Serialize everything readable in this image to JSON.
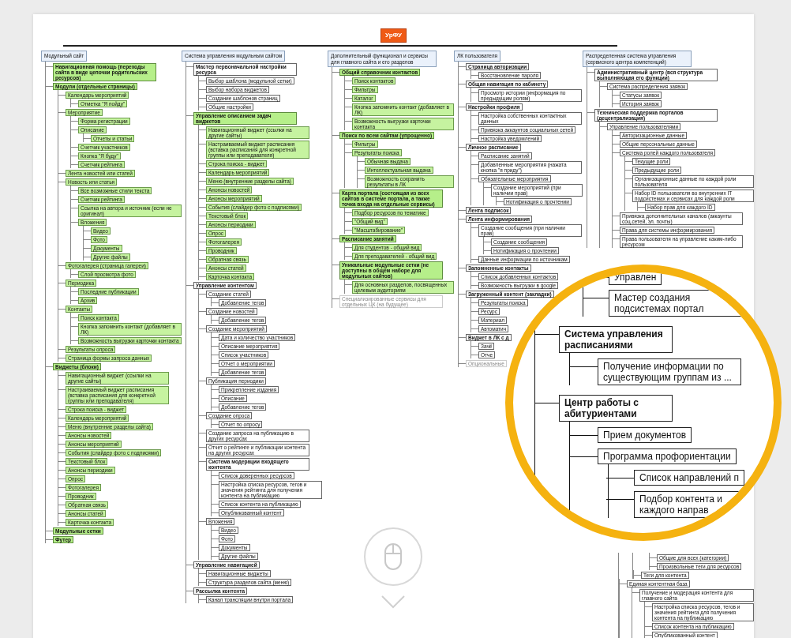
{
  "root": {
    "text": "УрФУ"
  },
  "columns": [
    {
      "title": "Модульный сайт",
      "items": [
        {
          "text": "Навигационная помощь (переходы сайта в виде цепочки родительских ресурсов)",
          "kind": "module"
        },
        {
          "text": "Модули (отдельные страницы)",
          "kind": "module",
          "children": [
            {
              "text": "Календарь мероприятий",
              "kind": "feature",
              "children": [
                {
                  "text": "Отметка \"Я пойду\"",
                  "kind": "feature"
                }
              ]
            },
            {
              "text": "Мероприятие",
              "kind": "feature",
              "children": [
                {
                  "text": "Форма регистрации",
                  "kind": "feature"
                },
                {
                  "text": "Описание",
                  "kind": "feature",
                  "children": [
                    {
                      "text": "Отчеты и статьи",
                      "kind": "feature"
                    }
                  ]
                },
                {
                  "text": "Счетчик участников",
                  "kind": "feature"
                },
                {
                  "text": "Кнопка \"Я буду\"",
                  "kind": "feature"
                },
                {
                  "text": "Счетчик рейтинга",
                  "kind": "feature"
                }
              ]
            },
            {
              "text": "Лента новостей или статей",
              "kind": "feature"
            },
            {
              "text": "Новость или статья",
              "kind": "feature",
              "children": [
                {
                  "text": "Все возможные стили текста",
                  "kind": "feature"
                },
                {
                  "text": "Счетчик рейтинга",
                  "kind": "feature"
                },
                {
                  "text": "Ссылка на автора и источник (если не оригинал)",
                  "kind": "feature"
                },
                {
                  "text": "Вложения",
                  "kind": "feature",
                  "children": [
                    {
                      "text": "Видео",
                      "kind": "feature"
                    },
                    {
                      "text": "Фото",
                      "kind": "feature"
                    },
                    {
                      "text": "Документы",
                      "kind": "feature"
                    },
                    {
                      "text": "Другие файлы",
                      "kind": "feature"
                    }
                  ]
                }
              ]
            },
            {
              "text": "Фотогалерея (страница галереи)",
              "kind": "feature",
              "children": [
                {
                  "text": "Слой просмотра фото",
                  "kind": "feature"
                }
              ]
            },
            {
              "text": "Периодика",
              "kind": "feature",
              "children": [
                {
                  "text": "Последние публикации",
                  "kind": "feature"
                },
                {
                  "text": "Архив",
                  "kind": "feature"
                }
              ]
            },
            {
              "text": "Контакты",
              "kind": "feature",
              "children": [
                {
                  "text": "Поиск контакта",
                  "kind": "feature"
                },
                {
                  "text": "Кнопка запомнить контакт (добавляет в ЛК)",
                  "kind": "feature"
                },
                {
                  "text": "Возможность выгрузки карточки контакта",
                  "kind": "feature"
                }
              ]
            },
            {
              "text": "Результаты опроса",
              "kind": "feature"
            },
            {
              "text": "Страница формы запроса данных",
              "kind": "feature"
            }
          ]
        },
        {
          "text": "Виджеты (блоки)",
          "kind": "module",
          "children": [
            {
              "text": "Навигационный виджет (ссылки на другие сайты)",
              "kind": "feature"
            },
            {
              "text": "Настраиваемый виджет расписания (вставка расписания для конкретной группы или преподавателя)",
              "kind": "feature"
            },
            {
              "text": "Строка поиска - виджет",
              "kind": "feature"
            },
            {
              "text": "Календарь мероприятий",
              "kind": "feature"
            },
            {
              "text": "Меню (внутренние разделы сайта)",
              "kind": "feature"
            },
            {
              "text": "Анонсы новостей",
              "kind": "feature"
            },
            {
              "text": "Анонсы мероприятий",
              "kind": "feature"
            },
            {
              "text": "События (слайдер фото с подписями)",
              "kind": "feature"
            },
            {
              "text": "Текстовый блок",
              "kind": "feature"
            },
            {
              "text": "Анонсы периодики",
              "kind": "feature"
            },
            {
              "text": "Опрос",
              "kind": "feature"
            },
            {
              "text": "Фотогалерея",
              "kind": "feature"
            },
            {
              "text": "Проводник",
              "kind": "feature"
            },
            {
              "text": "Обратная связь",
              "kind": "feature"
            },
            {
              "text": "Анонсы статей",
              "kind": "feature"
            },
            {
              "text": "Карточка контакта",
              "kind": "feature"
            }
          ]
        },
        {
          "text": "Модульные сетки",
          "kind": "module"
        },
        {
          "text": "Футер",
          "kind": "module"
        }
      ]
    },
    {
      "title": "Система управления модульным сайтом",
      "items": [
        {
          "text": "Мастер первоначальной настройки ресурса",
          "kind": "group",
          "children": [
            {
              "text": "Выбор шаблона (модульной сетки)",
              "kind": "item"
            },
            {
              "text": "Выбор набора виджетов",
              "kind": "item"
            },
            {
              "text": "Создание шаблонов страниц",
              "kind": "item"
            },
            {
              "text": "Общие настройки",
              "kind": "item"
            }
          ]
        },
        {
          "text": "Управление описанием задач виджетов",
          "kind": "module",
          "children": [
            {
              "text": "Навигационный виджет (ссылки на другие сайты)",
              "kind": "feature"
            },
            {
              "text": "Настраиваемый виджет расписания (вставка расписания для конкретной группы или преподавателя)",
              "kind": "feature"
            },
            {
              "text": "Строка поиска - виджет",
              "kind": "feature"
            },
            {
              "text": "Календарь мероприятий",
              "kind": "feature"
            },
            {
              "text": "Меню (внутренние разделы сайта)",
              "kind": "feature"
            },
            {
              "text": "Анонсы новостей",
              "kind": "feature"
            },
            {
              "text": "Анонсы мероприятий",
              "kind": "feature"
            },
            {
              "text": "События (слайдер фото с подписями)",
              "kind": "feature"
            },
            {
              "text": "Текстовый блок",
              "kind": "feature"
            },
            {
              "text": "Анонсы периодики",
              "kind": "feature"
            },
            {
              "text": "Опрос",
              "kind": "feature"
            },
            {
              "text": "Фотогалерея",
              "kind": "feature"
            },
            {
              "text": "Проводник",
              "kind": "feature"
            },
            {
              "text": "Обратная связь",
              "kind": "feature"
            },
            {
              "text": "Анонсы статей",
              "kind": "feature"
            },
            {
              "text": "Карточка контакта",
              "kind": "feature"
            }
          ]
        },
        {
          "text": "Управление контентом",
          "kind": "group",
          "children": [
            {
              "text": "Создание статей",
              "kind": "item",
              "children": [
                {
                  "text": "Добавление тегов",
                  "kind": "item"
                }
              ]
            },
            {
              "text": "Создание новостей",
              "kind": "item",
              "children": [
                {
                  "text": "Добавление тегов",
                  "kind": "item"
                }
              ]
            },
            {
              "text": "Создание мероприятий",
              "kind": "item",
              "children": [
                {
                  "text": "Дата и количество участников",
                  "kind": "item"
                },
                {
                  "text": "Описание мероприятия",
                  "kind": "item"
                },
                {
                  "text": "Список участников",
                  "kind": "item"
                },
                {
                  "text": "Отчет о мероприятии",
                  "kind": "item"
                },
                {
                  "text": "Добавление тегов",
                  "kind": "item"
                }
              ]
            },
            {
              "text": "Публикация периодики",
              "kind": "item",
              "children": [
                {
                  "text": "Прикрепление издания",
                  "kind": "item"
                },
                {
                  "text": "Описание",
                  "kind": "item"
                },
                {
                  "text": "Добавление тегов",
                  "kind": "item"
                }
              ]
            },
            {
              "text": "Создание опроса",
              "kind": "item",
              "children": [
                {
                  "text": "Отчет по опросу",
                  "kind": "item"
                }
              ]
            },
            {
              "text": "Создание запроса на публикацию в других ресурсах",
              "kind": "item"
            },
            {
              "text": "Отчет о рейтинге и публикации контента на других ресурсах",
              "kind": "item"
            },
            {
              "text": "Система модерации входящего контента",
              "kind": "group",
              "children": [
                {
                  "text": "Список доверенных ресурсов",
                  "kind": "item"
                },
                {
                  "text": "Настройка списка ресурсов, тегов и значения рейтинга для получения контента на публикацию",
                  "kind": "item"
                },
                {
                  "text": "Список контента на публикацию",
                  "kind": "item"
                },
                {
                  "text": "Опубликованный контент",
                  "kind": "item"
                }
              ]
            },
            {
              "text": "Вложения",
              "kind": "item",
              "children": [
                {
                  "text": "Видео",
                  "kind": "item"
                },
                {
                  "text": "Фото",
                  "kind": "item"
                },
                {
                  "text": "Документы",
                  "kind": "item"
                },
                {
                  "text": "Другие файлы",
                  "kind": "item"
                }
              ]
            }
          ]
        },
        {
          "text": "Управление навигацией",
          "kind": "group",
          "children": [
            {
              "text": "Навигационные виджеты",
              "kind": "item"
            },
            {
              "text": "Структура разделов сайта (меню)",
              "kind": "item"
            }
          ]
        },
        {
          "text": "Рассылка контента",
          "kind": "group",
          "children": [
            {
              "text": "Канал трансляции внутри портала",
              "kind": "item"
            }
          ]
        }
      ]
    },
    {
      "title": "Дополнительный функционал и сервисы для главного сайта и его разделов",
      "items": [
        {
          "text": "Общий справочник контактов",
          "kind": "module",
          "children": [
            {
              "text": "Поиск контактов",
              "kind": "feature"
            },
            {
              "text": "Фильтры",
              "kind": "feature"
            },
            {
              "text": "Каталог",
              "kind": "feature"
            },
            {
              "text": "Кнопка запомнить контакт (добавляет в ЛК)",
              "kind": "feature"
            },
            {
              "text": "Возможность выгрузки карточки контакта",
              "kind": "feature"
            }
          ]
        },
        {
          "text": "Поиск по всем сайтам (упрощенно)",
          "kind": "module",
          "children": [
            {
              "text": "Фильтры",
              "kind": "feature"
            },
            {
              "text": "Результаты поиска",
              "kind": "feature",
              "children": [
                {
                  "text": "Обычная выдача",
                  "kind": "feature"
                },
                {
                  "text": "Интеллектуальная выдача",
                  "kind": "feature"
                },
                {
                  "text": "Возможность сохранить результаты в ЛК",
                  "kind": "feature"
                }
              ]
            }
          ]
        },
        {
          "text": "Карта портала (состоящая из всех сайтов в системе портала, а также точка входа на отдельные сервисы)",
          "kind": "module",
          "children": [
            {
              "text": "Подбор ресурсов по тематике",
              "kind": "feature"
            },
            {
              "text": "\"Общий вид\"",
              "kind": "feature"
            },
            {
              "text": "\"Масштабирование\"",
              "kind": "feature"
            }
          ]
        },
        {
          "text": "Расписание занятий",
          "kind": "module",
          "children": [
            {
              "text": "Для студентов - общий вид",
              "kind": "feature"
            },
            {
              "text": "Для преподавателей - общий вид",
              "kind": "feature"
            }
          ]
        },
        {
          "text": "Уникальные модульные сетки (не доступны в общем наборе для модульных сайтов)",
          "kind": "module",
          "children": [
            {
              "text": "Для основных разделов, посвященных целевым аудиториям",
              "kind": "feature"
            }
          ]
        }
      ],
      "footnote": "Специализированные сервисы для отдельных ЦК (на будущее)"
    },
    {
      "title": "ЛК пользователя",
      "items": [
        {
          "text": "Страница авторизации",
          "kind": "group",
          "children": [
            {
              "text": "Восстановление пароля",
              "kind": "item"
            }
          ]
        },
        {
          "text": "Общая навигация по кабинету",
          "kind": "group",
          "children": [
            {
              "text": "Просмотр истории (информация по предыдущим ролям)",
              "kind": "item"
            }
          ]
        },
        {
          "text": "Настройки профиля",
          "kind": "group",
          "children": [
            {
              "text": "Настройка собственных контактных данных",
              "kind": "item"
            },
            {
              "text": "Привязка аккаунтов социальных сетей",
              "kind": "item"
            },
            {
              "text": "Настройка уведомлений",
              "kind": "item"
            }
          ]
        },
        {
          "text": "Личное расписание",
          "kind": "group",
          "children": [
            {
              "text": "Расписание занятий",
              "kind": "item"
            },
            {
              "text": "Добавленные мероприятия (нажата кнопка \"я приду\")",
              "kind": "item"
            },
            {
              "text": "Обязательные мероприятия",
              "kind": "item",
              "children": [
                {
                  "text": "Создание мероприятий (при наличии прав)",
                  "kind": "item",
                  "children": [
                    {
                      "text": "Нотификация о прочтении",
                      "kind": "item"
                    }
                  ]
                }
              ]
            }
          ]
        },
        {
          "text": "Лента подписок",
          "kind": "group"
        },
        {
          "text": "Лента информирования",
          "kind": "group",
          "children": [
            {
              "text": "Создание сообщения (при наличии прав)",
              "kind": "item",
              "children": [
                {
                  "text": "Создание сообщения",
                  "kind": "item"
                },
                {
                  "text": "Нотификация о прочтении",
                  "kind": "item"
                }
              ]
            },
            {
              "text": "Данные информации по источникам",
              "kind": "item"
            }
          ]
        },
        {
          "text": "Запомненные контакты",
          "kind": "group",
          "children": [
            {
              "text": "Список добавленных контактов",
              "kind": "item"
            },
            {
              "text": "Возможность выгрузки в google",
              "kind": "item"
            }
          ]
        },
        {
          "text": "Загруженный контент (закладки)",
          "kind": "group",
          "children": [
            {
              "text": "Результаты поиска",
              "kind": "item"
            },
            {
              "text": "Ресурс",
              "kind": "item"
            },
            {
              "text": "Материал",
              "kind": "item"
            },
            {
              "text": "Автоматич",
              "kind": "item"
            }
          ]
        },
        {
          "text": "Виджет в ЛК с д",
          "kind": "group",
          "children": [
            {
              "text": "Зачё",
              "kind": "item"
            },
            {
              "text": "Отче",
              "kind": "item"
            }
          ]
        }
      ],
      "footnote": "Опциональные"
    },
    {
      "title": "Распределенная система управления (сервисного центра компетенций)",
      "items": [
        {
          "text": "Административный центр (вся структура выполняющая его функции)",
          "kind": "group",
          "children": [
            {
              "text": "Система распределения заявок",
              "kind": "item",
              "children": [
                {
                  "text": "Статусы заявок",
                  "kind": "item"
                },
                {
                  "text": "История заявок",
                  "kind": "item"
                }
              ]
            }
          ]
        },
        {
          "text": "Техническая поддержка порталов (децентрализация)",
          "kind": "group",
          "children": [
            {
              "text": "Управление пользователями",
              "kind": "item",
              "children": [
                {
                  "text": "Авторизационные данные",
                  "kind": "item"
                },
                {
                  "text": "Общие персональные данные",
                  "kind": "item"
                },
                {
                  "text": "Система ролей каждого пользователя",
                  "kind": "item",
                  "children": [
                    {
                      "text": "Текущие роли",
                      "kind": "item"
                    },
                    {
                      "text": "Предыдущие роли",
                      "kind": "item"
                    },
                    {
                      "text": "Организационные данные по каждой роли пользователя",
                      "kind": "item"
                    },
                    {
                      "text": "Набор ID пользователя во внутренних IT подсистемах и сервисах для каждой роли",
                      "kind": "item",
                      "children": [
                        {
                          "text": "Набор прав для каждого ID",
                          "kind": "item"
                        }
                      ]
                    }
                  ]
                },
                {
                  "text": "Привязка дополнительных каналов (аккаунты соц.сетей, эл. почты)",
                  "kind": "item"
                },
                {
                  "text": "Права для системы информирования",
                  "kind": "item"
                },
                {
                  "text": "Права пользователя на управление каким-либо ресурсом",
                  "kind": "item"
                }
              ]
            }
          ]
        }
      ],
      "lower": {
        "inner_items": [
          {
            "text": "Общие для всех (категории)",
            "kind": "item"
          },
          {
            "text": "Произвольные теги для ресурсов",
            "kind": "item"
          }
        ],
        "middle_items": [
          {
            "text": "Теги для контента",
            "kind": "item"
          }
        ],
        "outer_items": [
          {
            "text": "Единая контентная база",
            "kind": "item",
            "children": [
              {
                "text": "Получение и модерация контента для главного сайта",
                "kind": "item",
                "children": [
                  {
                    "text": "Настройка списка ресурсов, тегов и значения рейтинга для получения контента на публикацию",
                    "kind": "item"
                  },
                  {
                    "text": "Список контента на публикацию",
                    "kind": "item"
                  },
                  {
                    "text": "Опубликованный контент",
                    "kind": "item"
                  }
                ]
              }
            ]
          }
        ]
      }
    }
  ],
  "magnifier": {
    "upper_items": [
      {
        "text": "Управлен",
        "kind": "item"
      },
      {
        "text": "Мастер создания подсистемах портал",
        "kind": "item"
      }
    ],
    "items": [
      {
        "text": "Система управления расписаниями",
        "kind": "group",
        "children": [
          {
            "text": "Получение информации по существующим группам из ...",
            "kind": "item"
          }
        ]
      },
      {
        "text": "Центр работы с абитуриентами",
        "kind": "group",
        "children": [
          {
            "text": "Прием документов",
            "kind": "item"
          },
          {
            "text": "Программа профориентации",
            "kind": "item",
            "children": [
              {
                "text": "Список направлений п",
                "kind": "item"
              },
              {
                "text": "Подбор контента и каждого направ",
                "kind": "item"
              }
            ]
          }
        ]
      }
    ]
  }
}
